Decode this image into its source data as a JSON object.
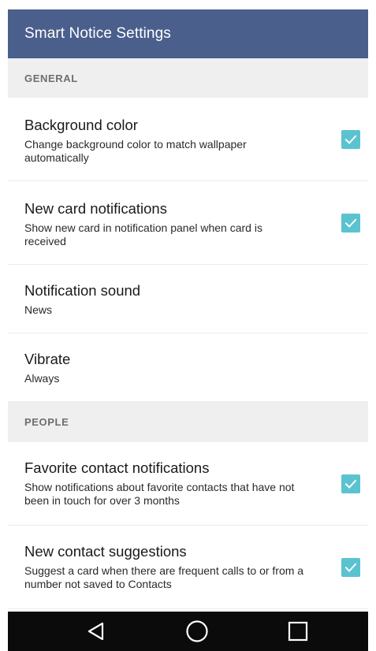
{
  "appbar": {
    "title": "Smart Notice Settings",
    "color": "#4a5f8c"
  },
  "sections": {
    "general": {
      "header": "GENERAL",
      "items": [
        {
          "title": "Background color",
          "subtitle": "Change background color to match wallpaper automatically",
          "checked": true
        },
        {
          "title": "New card notifications",
          "subtitle": "Show new card in notification panel when card is received",
          "checked": true
        },
        {
          "title": "Notification sound",
          "subtitle": "News"
        },
        {
          "title": "Vibrate",
          "subtitle": "Always"
        }
      ]
    },
    "people": {
      "header": "PEOPLE",
      "items": [
        {
          "title": "Favorite contact notifications",
          "subtitle": "Show notifications about favorite contacts that have not been in touch for over 3 months",
          "checked": true
        },
        {
          "title": "New contact suggestions",
          "subtitle": "Suggest a card when there are frequent calls to or from a number not saved to Contacts",
          "checked": true
        }
      ]
    }
  },
  "navbar": {
    "back_icon": "back-triangle-icon",
    "home_icon": "home-circle-icon",
    "recents_icon": "recents-square-icon"
  },
  "accent_color": "#5bc3d0"
}
